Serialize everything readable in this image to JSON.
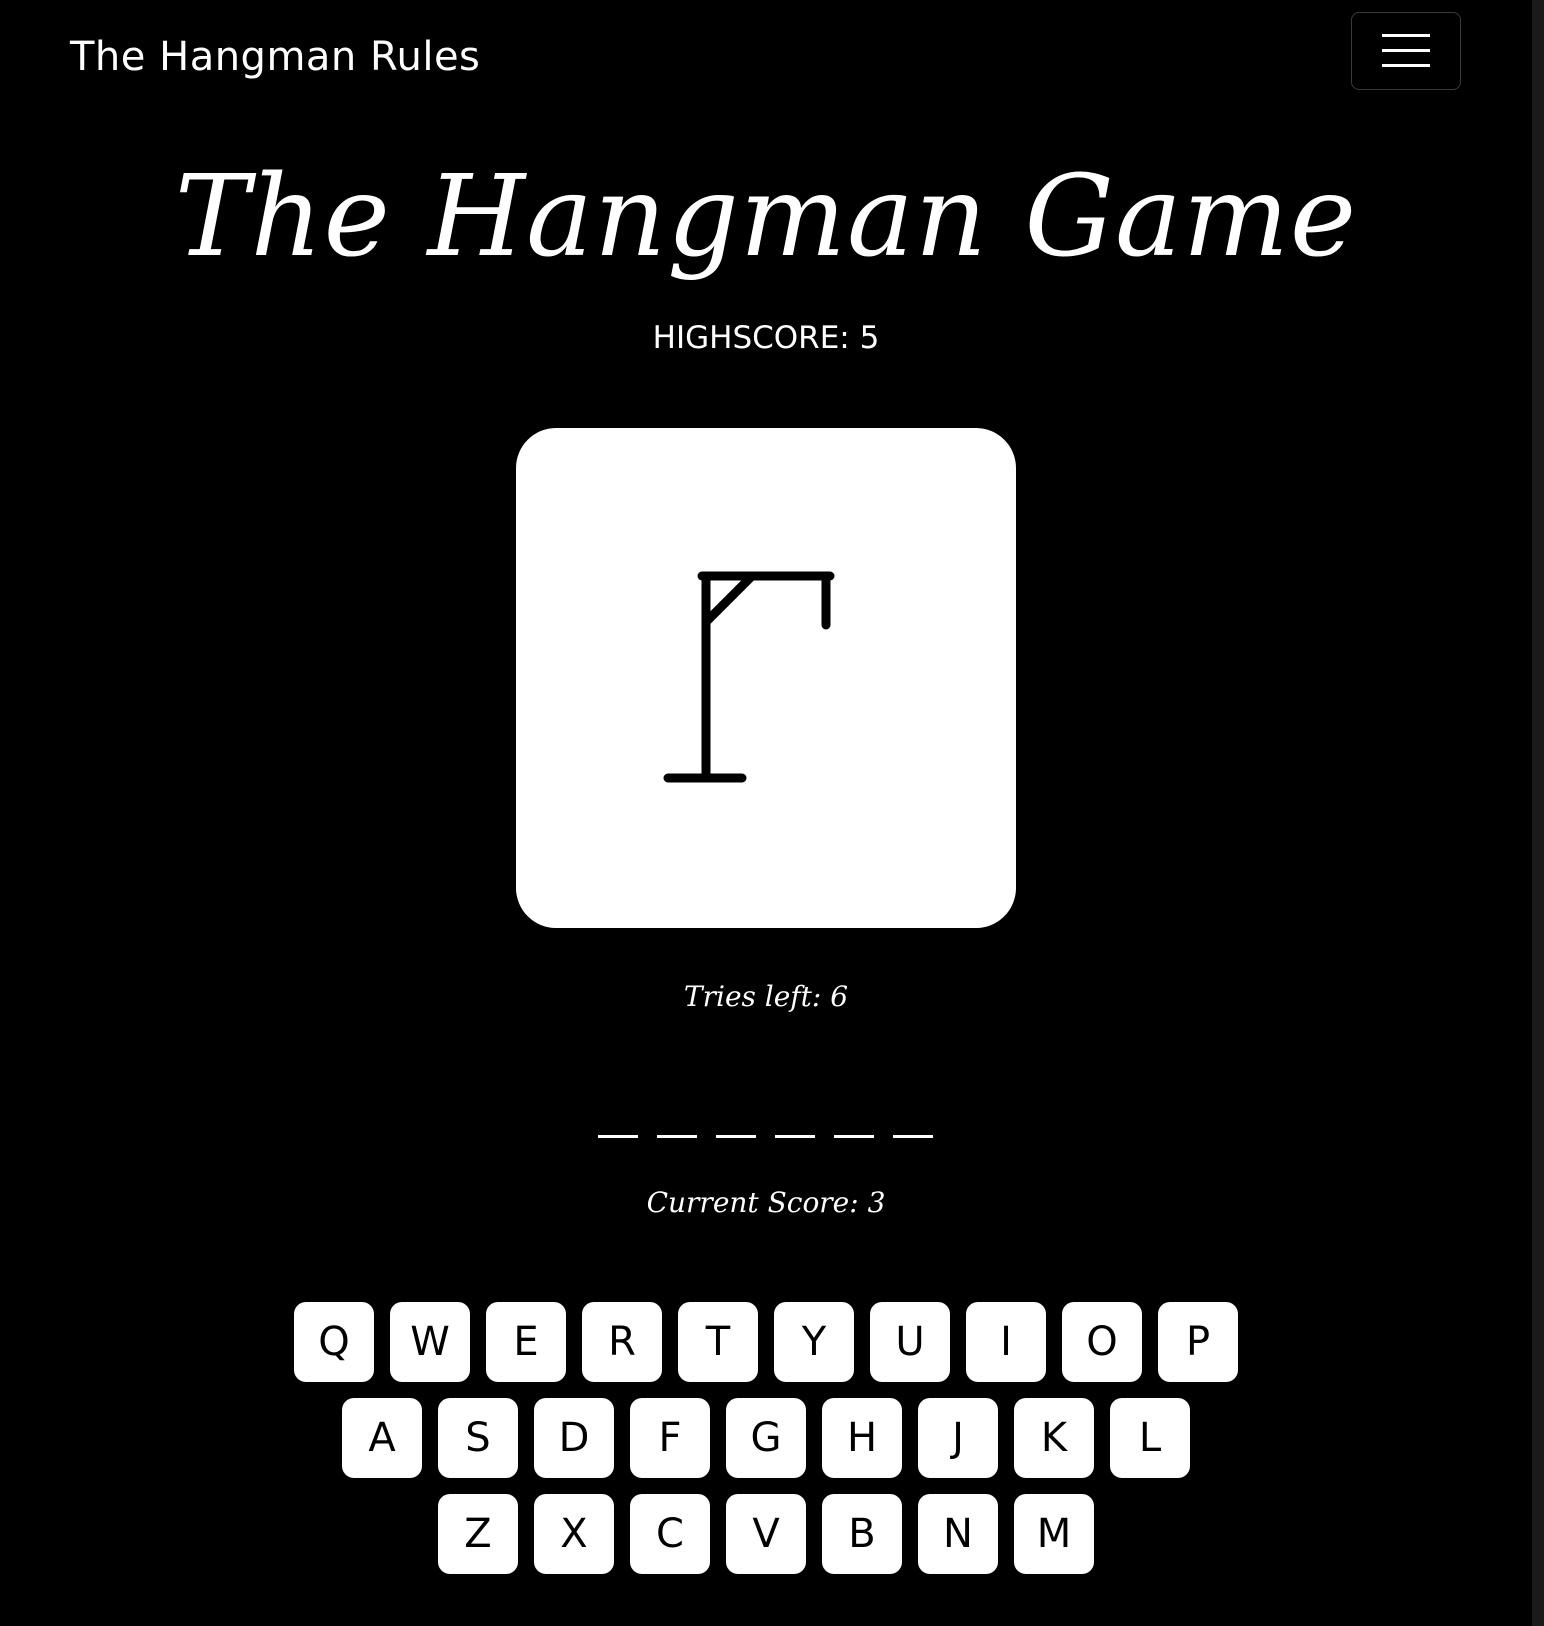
{
  "navbar": {
    "brand": "The Hangman Rules",
    "menu_icon": "hamburger-menu-icon"
  },
  "game": {
    "title": "The Hangman Game",
    "highscore": "HIGHSCORE: 5",
    "tries_left": "Tries left: 6",
    "word_length": 6,
    "current_score": "Current Score: 3"
  },
  "keyboard": {
    "rows": [
      [
        "Q",
        "W",
        "E",
        "R",
        "T",
        "Y",
        "U",
        "I",
        "O",
        "P"
      ],
      [
        "A",
        "S",
        "D",
        "F",
        "G",
        "H",
        "J",
        "K",
        "L"
      ],
      [
        "Z",
        "X",
        "C",
        "V",
        "B",
        "N",
        "M"
      ]
    ]
  },
  "colors": {
    "background": "#000000",
    "foreground": "#ffffff",
    "key_text": "#000000"
  }
}
